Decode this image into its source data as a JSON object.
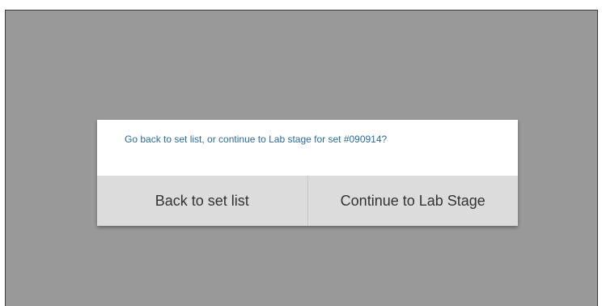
{
  "dialog": {
    "message": "Go back to set list, or continue to Lab stage for set #090914?",
    "buttons": {
      "back_label": "Back to set list",
      "continue_label": "Continue to Lab Stage"
    }
  },
  "colors": {
    "screen_background": "#999999",
    "message_text": "#2b6a9c",
    "button_background": "#dcdcdc"
  }
}
